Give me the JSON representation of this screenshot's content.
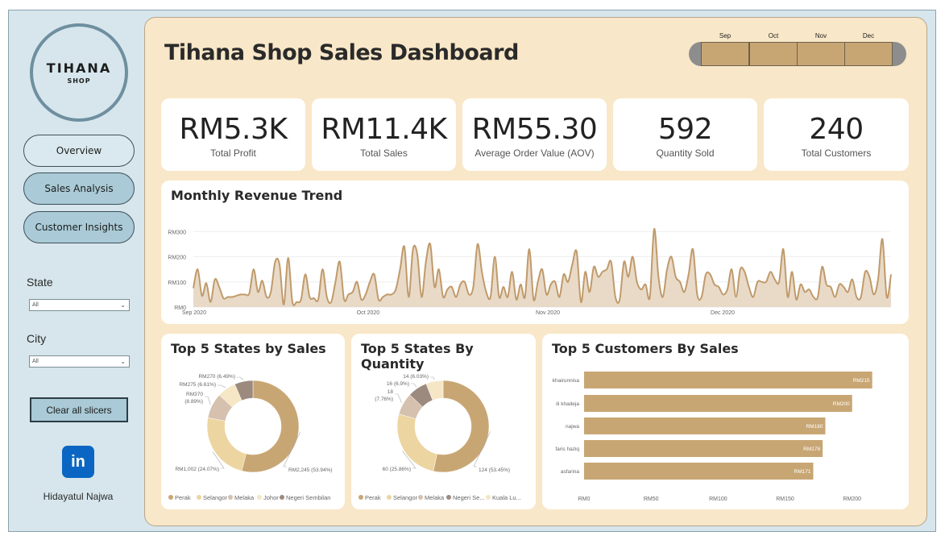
{
  "brand": {
    "name": "TIHANA",
    "sub": "SHOP"
  },
  "nav": {
    "overview": "Overview",
    "sales_analysis": "Sales Analysis",
    "customer_insights": "Customer Insights"
  },
  "filters": {
    "state_label": "State",
    "state_value": "All",
    "city_label": "City",
    "city_value": "All",
    "clear_label": "Clear all slicers"
  },
  "author": {
    "name": "Hidayatul Najwa",
    "icon": "linkedin-icon",
    "icon_text": "in"
  },
  "dashboard_title": "Tihana Shop Sales Dashboard",
  "timeline": {
    "months": [
      "Sep",
      "Oct",
      "Nov",
      "Dec"
    ]
  },
  "kpis": [
    {
      "value": "RM5.3K",
      "label": "Total Profit"
    },
    {
      "value": "RM11.4K",
      "label": "Total Sales"
    },
    {
      "value": "RM55.30",
      "label": "Average Order Value (AOV)"
    },
    {
      "value": "592",
      "label": "Quantity Sold"
    },
    {
      "value": "240",
      "label": "Total Customers"
    }
  ],
  "colors": {
    "accent": "#c8a674",
    "panel": "#f8e7c8",
    "sidebar": "#d6e6ec",
    "navActive": "#a9cad6"
  },
  "chart_data": [
    {
      "type": "area",
      "title": "Monthly Revenue Trend",
      "y_ticks": [
        "RM0",
        "RM100",
        "RM200",
        "RM300"
      ],
      "x_ticks": [
        "Sep 2020",
        "Oct 2020",
        "Nov 2020",
        "Dec 2020"
      ],
      "ylim": [
        0,
        320
      ],
      "values": [
        75,
        150,
        45,
        95,
        20,
        110,
        80,
        35,
        40,
        40,
        45,
        50,
        50,
        55,
        150,
        60,
        105,
        40,
        60,
        180,
        170,
        10,
        195,
        20,
        20,
        30,
        130,
        40,
        35,
        30,
        150,
        40,
        20,
        100,
        180,
        30,
        50,
        60,
        100,
        30,
        50,
        100,
        130,
        30,
        40,
        50,
        50,
        70,
        150,
        240,
        40,
        230,
        210,
        40,
        180,
        250,
        80,
        150,
        40,
        70,
        80,
        40,
        90,
        100,
        50,
        80,
        250,
        140,
        60,
        40,
        200,
        40,
        80,
        40,
        140,
        30,
        90,
        40,
        230,
        30,
        100,
        150,
        50,
        90,
        100,
        40,
        130,
        100,
        170,
        220,
        20,
        140,
        60,
        160,
        120,
        140,
        150,
        180,
        40,
        30,
        180,
        120,
        200,
        100,
        70,
        90,
        40,
        310,
        120,
        40,
        150,
        200,
        120,
        100,
        60,
        130,
        230,
        50,
        40,
        130,
        130,
        90,
        80,
        50,
        70,
        150,
        40,
        150,
        140,
        80,
        40,
        100,
        100,
        100,
        140,
        110,
        100,
        230,
        40,
        140,
        30,
        90,
        60,
        70,
        40,
        40,
        160,
        90,
        80,
        40,
        90,
        80,
        60,
        110,
        40,
        40,
        140,
        120,
        50,
        110,
        270,
        40,
        130
      ],
      "grid": true
    },
    {
      "type": "pie",
      "title": "Top 5 States by Sales",
      "labels": [
        "Perak",
        "Selangor",
        "Melaka",
        "Johor",
        "Negeri Sembilan"
      ],
      "values": [
        2245,
        1002,
        370,
        275,
        270
      ],
      "data_labels": [
        "RM2,245 (53.94%)",
        "RM1,002 (24.07%)",
        "RM370\n(8.89%)",
        "RM275 (6.61%)",
        "RM270 (6.49%)"
      ],
      "colors": [
        "#c8a674",
        "#ecd5a0",
        "#d6c0ae",
        "#f5e6c5",
        "#9d8a7e"
      ],
      "legend": "bottom"
    },
    {
      "type": "pie",
      "title": "Top 5 States By Quantity",
      "labels": [
        "Perak",
        "Selangor",
        "Melaka",
        "Negeri Se...",
        "Kuala Lu..."
      ],
      "values": [
        124,
        60,
        18,
        16,
        14
      ],
      "data_labels": [
        "124 (53.45%)",
        "60 (25.86%)",
        "18\n(7.76%)",
        "16 (6.9%)",
        "14 (6.03%)"
      ],
      "colors": [
        "#c8a674",
        "#ecd5a0",
        "#d6c0ae",
        "#9d8a7e",
        "#f5e6c5"
      ],
      "legend": "bottom"
    },
    {
      "type": "bar",
      "orientation": "horizontal",
      "title": "Top 5 Customers By Sales",
      "categories": [
        "khairunnisa",
        "ili khadeja",
        "najwa",
        "faris haziq",
        "asfarina"
      ],
      "values": [
        215,
        200,
        180,
        178,
        171
      ],
      "data_labels": [
        "RM215",
        "RM200",
        "RM180",
        "RM178",
        "RM171"
      ],
      "x_ticks": [
        "RM0",
        "RM50",
        "RM100",
        "RM150",
        "RM200"
      ],
      "xlim": [
        0,
        220
      ]
    }
  ]
}
